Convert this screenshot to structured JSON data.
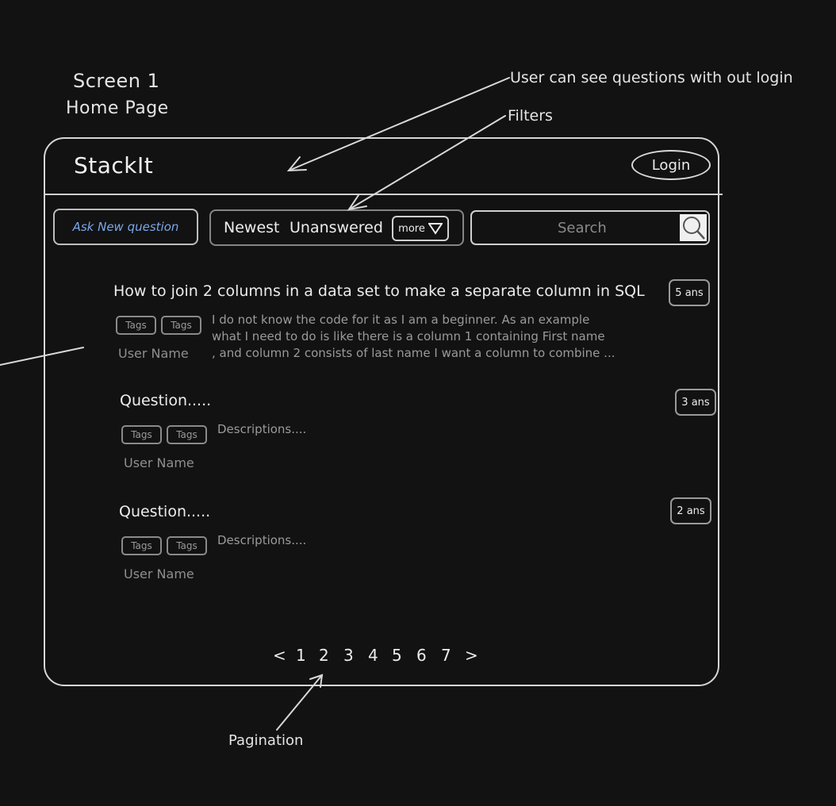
{
  "screen": {
    "label": "Screen 1",
    "subtitle": "Home Page"
  },
  "annotations": {
    "no_login": "User can see questions with out login",
    "filters": "Filters",
    "pagination": "Pagination"
  },
  "header": {
    "brand": "StackIt",
    "login_label": "Login"
  },
  "toolbar": {
    "ask_label": "Ask New question",
    "filters": [
      "Newest",
      "Unanswered"
    ],
    "more_label": "more",
    "search_placeholder": "Search"
  },
  "questions": [
    {
      "title": "How to join 2 columns in a data set to make a separate column in SQL",
      "answers": "5 ans",
      "tags": [
        "Tags",
        "Tags"
      ],
      "description_lines": [
        "I do not know the code for it as I am a beginner. As an example",
        "what I need to do is like there is a column 1 containing First name",
        ", and column 2 consists of last name I want a column to combine ..."
      ],
      "user": "User Name"
    },
    {
      "title": "Question.....",
      "answers": "3 ans",
      "tags": [
        "Tags",
        "Tags"
      ],
      "description_lines": [
        "Descriptions...."
      ],
      "user": "User Name"
    },
    {
      "title": "Question.....",
      "answers": "2 ans",
      "tags": [
        "Tags",
        "Tags"
      ],
      "description_lines": [
        "Descriptions...."
      ],
      "user": "User Name"
    }
  ],
  "pagination": {
    "prev": "<",
    "pages": [
      "1",
      "2",
      "3",
      "4",
      "5",
      "6",
      "7"
    ],
    "next": ">"
  }
}
